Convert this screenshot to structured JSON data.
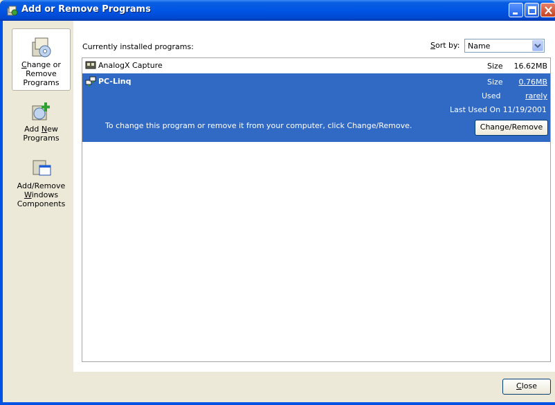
{
  "window": {
    "title": "Add or Remove Programs"
  },
  "nav": {
    "items": [
      {
        "label_pre": "C",
        "label_hot": "h",
        "label_post": "ange or Remove Programs",
        "l1a": "C",
        "l1u": "h",
        "l1b": "ange or",
        "l2": "Remove",
        "l3": "Programs"
      },
      {
        "l1": "Add ",
        "l1u": "N",
        "l1b": "ew",
        "l2": "Programs"
      },
      {
        "l1": "Add/Remove",
        "l2u": "W",
        "l2b": "indows",
        "l3": "Components"
      }
    ]
  },
  "content": {
    "header": "Currently installed programs:",
    "sort_label_hot": "S",
    "sort_label_rest": "ort by:",
    "sort_value": "Name"
  },
  "programs": [
    {
      "name": "AnalogX Capture",
      "size_label": "Size",
      "size": "16.62MB"
    },
    {
      "name": "PC-Linq",
      "size_label": "Size",
      "size": "0.76MB",
      "used_label": "Used",
      "used": "rarely",
      "last_used_label": "Last Used On",
      "last_used": "11/19/2001",
      "hint": "To change this program or remove it from your computer, click Change/Remove.",
      "button": "Change/Remove"
    }
  ],
  "footer": {
    "close_hot": "C",
    "close_pre": "",
    "close_rest": "se",
    "close_l": "l",
    "close_o": "o"
  },
  "colors": {
    "selected_row": "#316ac5",
    "titlebar": "#0055e5"
  }
}
